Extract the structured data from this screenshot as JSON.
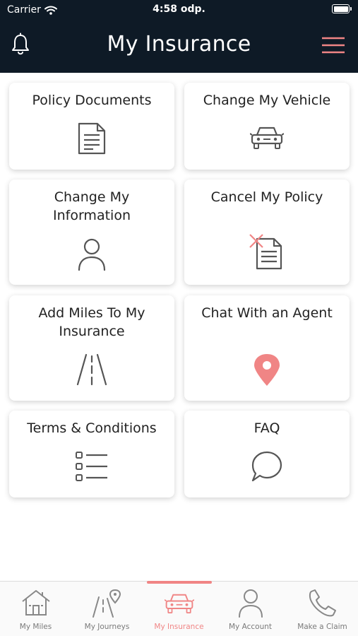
{
  "status_bar": {
    "carrier": "Carrier",
    "time": "4:58 odp."
  },
  "header": {
    "title": "My Insurance",
    "left_icon": "bell-icon",
    "right_icon": "hamburger-menu-icon"
  },
  "cards": [
    {
      "label": "Policy Documents",
      "icon": "document-icon"
    },
    {
      "label": "Change My Vehicle",
      "icon": "car-icon"
    },
    {
      "label": "Change My\nInformation",
      "icon": "person-icon"
    },
    {
      "label": "Cancel My Policy",
      "icon": "cancel-document-icon"
    },
    {
      "label": "Add Miles To My\nInsurance",
      "icon": "road-icon"
    },
    {
      "label": "Chat With an Agent",
      "icon": "location-pin-icon"
    },
    {
      "label": "Terms & Conditions",
      "icon": "list-icon"
    },
    {
      "label": "FAQ",
      "icon": "speech-bubble-icon"
    }
  ],
  "tabs": [
    {
      "label": "My Miles",
      "icon": "house-icon",
      "active": false
    },
    {
      "label": "My Journeys",
      "icon": "journey-road-icon",
      "active": false
    },
    {
      "label": "My Insurance",
      "icon": "car-icon",
      "active": true
    },
    {
      "label": "My Account",
      "icon": "person-icon",
      "active": false
    },
    {
      "label": "Make a Claim",
      "icon": "phone-icon",
      "active": false
    }
  ],
  "colors": {
    "header_bg": "#0e1a26",
    "accent": "#f08585",
    "icon_gray": "#555555"
  }
}
